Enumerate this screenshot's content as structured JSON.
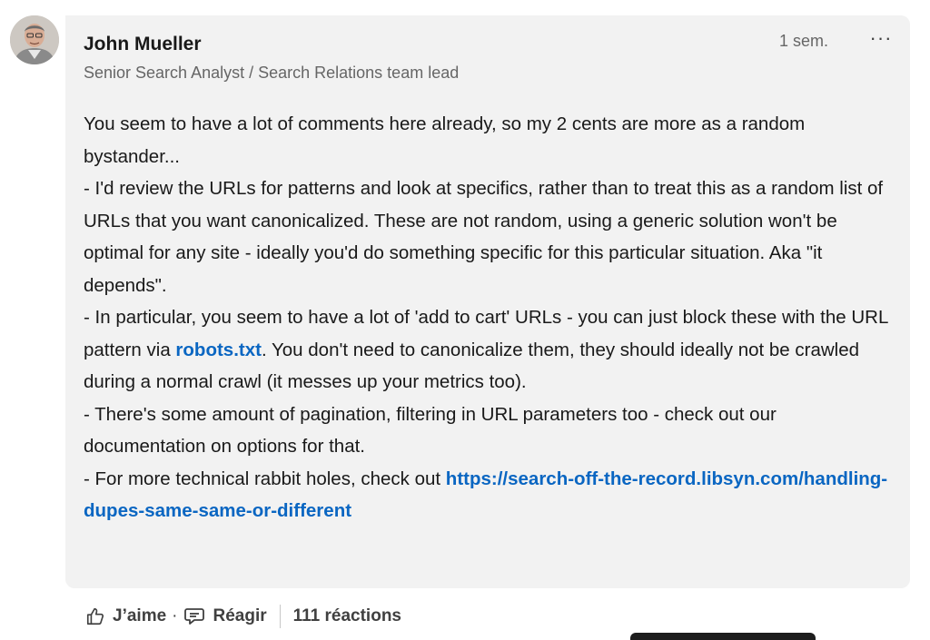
{
  "comment": {
    "author_name": "John Mueller",
    "author_headline": "Senior Search Analyst / Search Relations team lead",
    "timestamp": "1 sem.",
    "more_options_label": "···",
    "paragraphs": [
      {
        "text": "You seem to have a lot of comments here already, so my 2 cents are more as a random bystander..."
      },
      {
        "text": "- I'd review the URLs for patterns and look at specifics, rather than to treat this as a random list of URLs that you want canonicalized. These are not random, using a generic solution won't be optimal for any site - ideally you'd do something specific for this particular situation. Aka \"it depends\"."
      },
      {
        "before": "- In particular, you seem to have a lot of 'add to cart' URLs - you can just block these with the URL pattern via ",
        "link": "robots.txt",
        "after": ". You don't need to canonicalize them, they should ideally not be crawled during a normal crawl (it messes up your metrics too)."
      },
      {
        "text": "- There's some amount of pagination, filtering in URL parameters too - check out our documentation on options for that."
      },
      {
        "before": "- For more technical rabbit holes, check out ",
        "link": "https://search-off-the-record.libsyn.com/handling-dupes-same-same-or-different",
        "after": ""
      }
    ]
  },
  "actions": {
    "like_label": "J’aime",
    "dot": "·",
    "reply_label": "Réagir",
    "reactions_count": "111 réactions"
  },
  "colors": {
    "bubble_bg": "#f2f2f2",
    "link": "#0a66c2",
    "secondary_text": "#666666"
  },
  "icons": [
    "thumbs-up-icon",
    "comment-icon",
    "more-options-icon",
    "avatar"
  ]
}
